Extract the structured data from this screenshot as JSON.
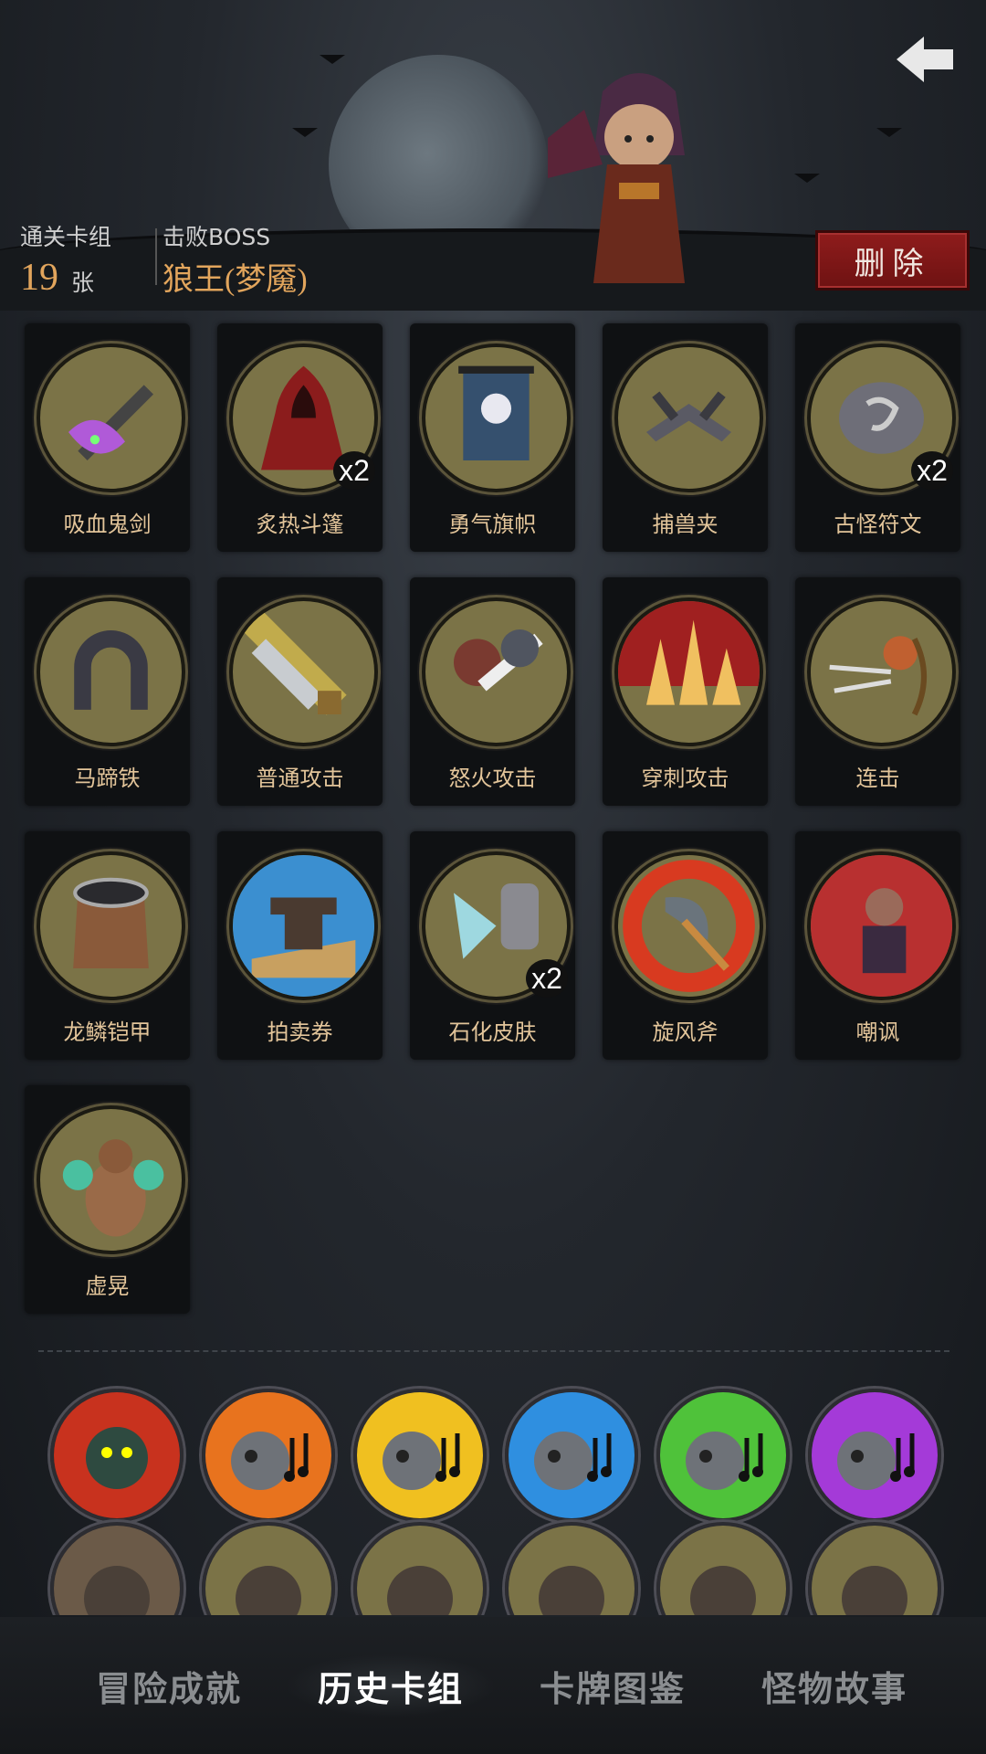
{
  "header": {
    "clear_deck_label": "通关卡组",
    "clear_count": "19",
    "count_unit": "张",
    "defeated_boss_label": "击败BOSS",
    "boss_name": "狼王(梦魇)",
    "delete_label": "删除"
  },
  "cards": [
    {
      "name": "吸血鬼剑",
      "icon": "vampire-sword-icon",
      "dup": ""
    },
    {
      "name": "炙热斗篷",
      "icon": "red-cloak-icon",
      "dup": "x2"
    },
    {
      "name": "勇气旗帜",
      "icon": "skull-banner-icon",
      "dup": ""
    },
    {
      "name": "捕兽夹",
      "icon": "bear-trap-icon",
      "dup": ""
    },
    {
      "name": "古怪符文",
      "icon": "rune-stone-icon",
      "dup": "x2"
    },
    {
      "name": "马蹄铁",
      "icon": "horseshoe-icon",
      "dup": ""
    },
    {
      "name": "普通攻击",
      "icon": "sword-strike-icon",
      "dup": ""
    },
    {
      "name": "怒火攻击",
      "icon": "rage-attack-icon",
      "dup": ""
    },
    {
      "name": "穿刺攻击",
      "icon": "spike-attack-icon",
      "dup": ""
    },
    {
      "name": "连击",
      "icon": "archer-combo-icon",
      "dup": ""
    },
    {
      "name": "龙鳞铠甲",
      "icon": "scale-armor-icon",
      "dup": ""
    },
    {
      "name": "拍卖券",
      "icon": "auction-gavel-icon",
      "dup": ""
    },
    {
      "name": "石化皮肤",
      "icon": "stone-skin-icon",
      "dup": "x2"
    },
    {
      "name": "旋风斧",
      "icon": "whirlwind-axe-icon",
      "dup": ""
    },
    {
      "name": "嘲讽",
      "icon": "taunt-rat-icon",
      "dup": ""
    },
    {
      "name": "虚晃",
      "icon": "feint-boxer-icon",
      "dup": ""
    }
  ],
  "bosses": [
    {
      "icon": "fire-demon-icon",
      "color": "#c8321e"
    },
    {
      "icon": "skull-bard-orange-icon",
      "color": "#e8731e"
    },
    {
      "icon": "skull-bard-yellow-icon",
      "color": "#f0c020"
    },
    {
      "icon": "skull-bard-blue-icon",
      "color": "#2f8fe0"
    },
    {
      "icon": "skull-bard-green-icon",
      "color": "#4fc23a"
    },
    {
      "icon": "skull-bard-purple-icon",
      "color": "#a43ad8"
    },
    {
      "icon": "cannon-icon",
      "color": "#6b5a48"
    },
    {
      "icon": "card-hand-icon",
      "color": "#7b7347"
    },
    {
      "icon": "blade-hand-icon",
      "color": "#7b7347"
    },
    {
      "icon": "goblin-icon",
      "color": "#7b7347"
    },
    {
      "icon": "vampire-icon",
      "color": "#7b7347"
    },
    {
      "icon": "brute-icon",
      "color": "#7b7347"
    }
  ],
  "tabs": [
    {
      "label": "冒险成就",
      "active": false
    },
    {
      "label": "历史卡组",
      "active": true
    },
    {
      "label": "卡牌图鉴",
      "active": false
    },
    {
      "label": "怪物故事",
      "active": false
    }
  ]
}
